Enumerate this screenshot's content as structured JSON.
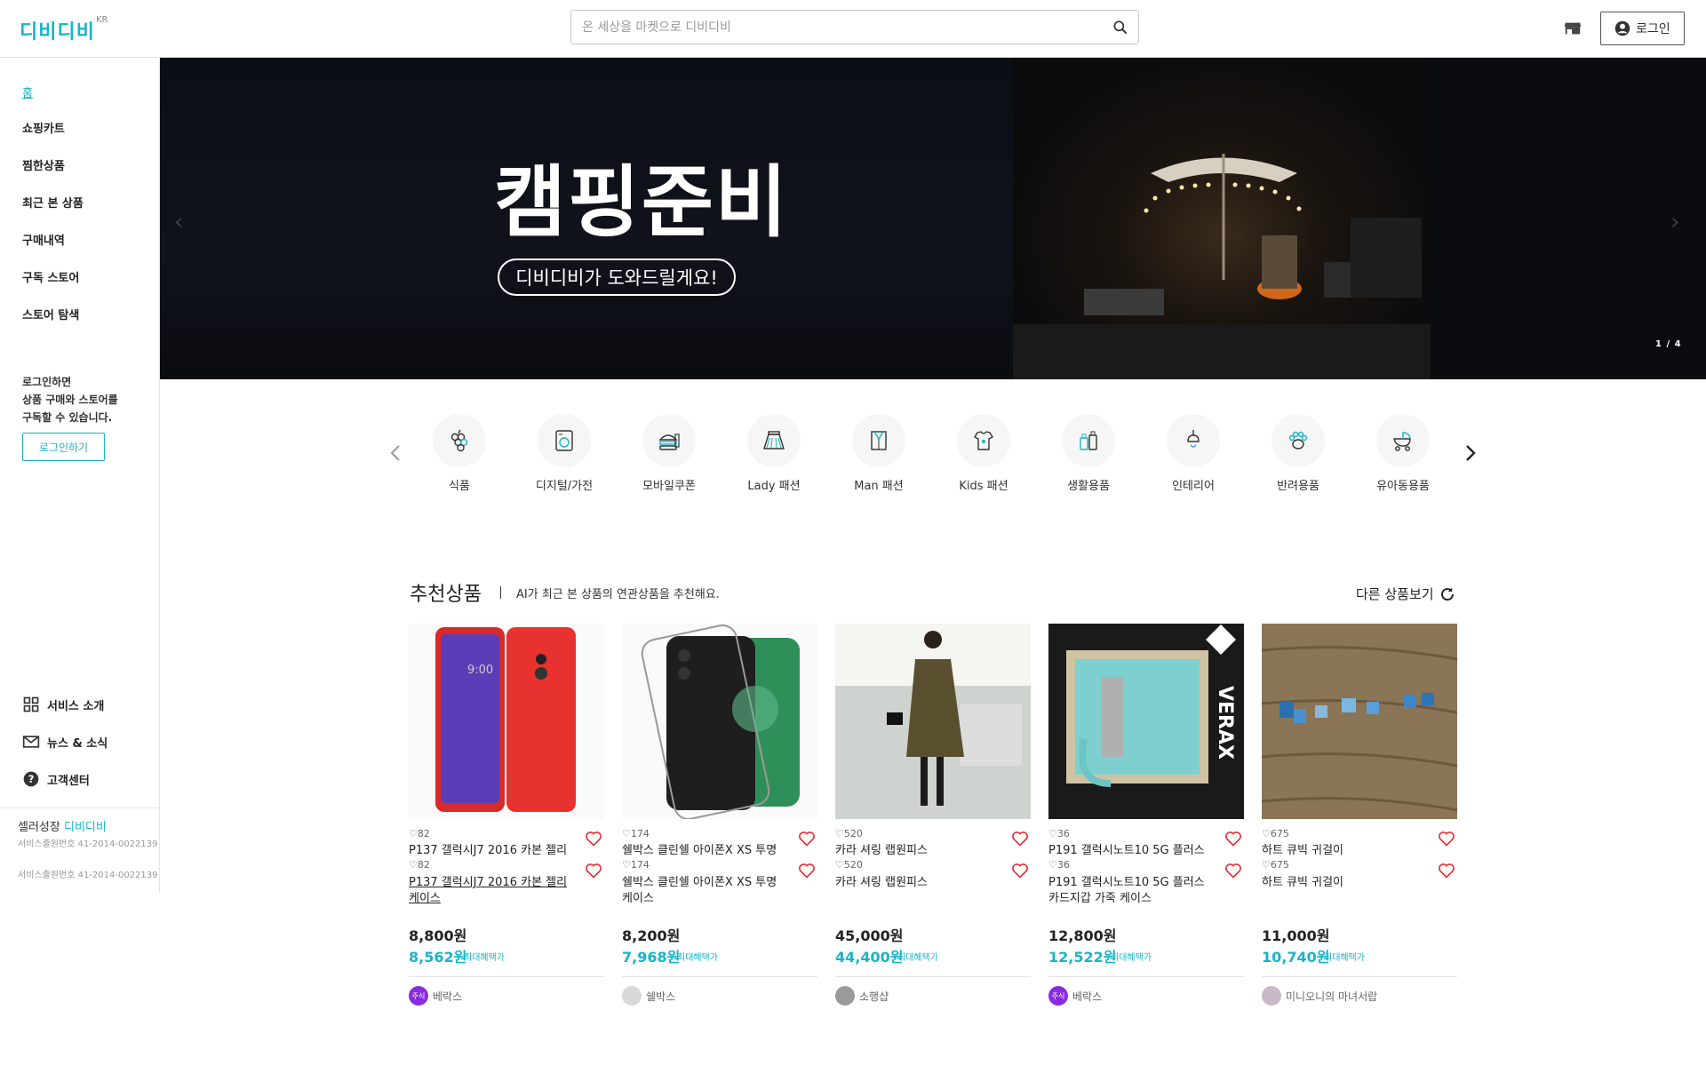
{
  "header": {
    "logo": "디비디비",
    "logo_sup": "KR",
    "search_placeholder": "온 세상을 마켓으로 디비디비",
    "login_label": "로그인"
  },
  "sidebar": {
    "nav": [
      {
        "label": "홈",
        "active": true
      },
      {
        "label": "쇼핑카트"
      },
      {
        "label": "찜한상품"
      },
      {
        "label": "최근 본 상품"
      },
      {
        "label": "구매내역"
      },
      {
        "label": "구독 스토어"
      },
      {
        "label": "스토어 탐색"
      }
    ],
    "login_note": [
      "로그인하면",
      "상품 구매와 스토어를",
      "구독할 수 있습니다."
    ],
    "login_button": "로그인하기",
    "links": [
      {
        "label": "서비스 소개",
        "icon": "grid-icon"
      },
      {
        "label": "뉴스 & 소식",
        "icon": "mail-icon"
      },
      {
        "label": "고객센터",
        "icon": "help-icon"
      }
    ],
    "seller_prefix": "셀러성장",
    "seller_brand": "디비디비",
    "biz_number": "서비스출원번호 41-2014-0022139"
  },
  "banner": {
    "title": "캠핑준비",
    "pill": "디비디비가 도와드릴게요!",
    "page": "1 / 4"
  },
  "categories": [
    {
      "label": "식품",
      "icon": "grapes-icon"
    },
    {
      "label": "디지털/가전",
      "icon": "washer-icon"
    },
    {
      "label": "모바일쿠폰",
      "icon": "burger-icon"
    },
    {
      "label": "Lady 패션",
      "icon": "skirt-icon"
    },
    {
      "label": "Man 패션",
      "icon": "shirt-icon"
    },
    {
      "label": "Kids 패션",
      "icon": "kids-shirt-icon"
    },
    {
      "label": "생활용품",
      "icon": "bottles-icon"
    },
    {
      "label": "인테리어",
      "icon": "lamp-icon"
    },
    {
      "label": "반려용품",
      "icon": "paw-icon"
    },
    {
      "label": "유아동용품",
      "icon": "stroller-icon"
    }
  ],
  "recommend": {
    "title": "추천상품",
    "subtitle": "AI가 최근 본 상품의 연관상품을 추천해요.",
    "more": "다른 상품보기",
    "products": [
      {
        "likes": "82",
        "name": "P137 갤럭시J7 2016 카본 젤리",
        "name_full": "P137 갤럭시J7 2016 카본 젤리 케이스",
        "price": "8,800원",
        "discount_price": "8,562원",
        "benefit": "최대혜택가",
        "store": "베락스",
        "store_avatar": "주식",
        "avatar_color": "#8a2be2"
      },
      {
        "likes": "174",
        "name": "쉘박스 클린쉘 아이폰X XS 투명",
        "name_full": "쉘박스 클린쉘 아이폰X XS 투명 케이스",
        "price": "8,200원",
        "discount_price": "7,968원",
        "benefit": "최대혜택가",
        "store": "쉘박스",
        "store_avatar": "",
        "avatar_color": "#d8d8d8"
      },
      {
        "likes": "520",
        "name": "카라 셔링 랩원피스",
        "name_full": "카라 셔링 랩원피스",
        "price": "45,000원",
        "discount_price": "44,400원",
        "benefit": "최대혜택가",
        "store": "소행샵",
        "store_avatar": "",
        "avatar_color": "#9a9a9a"
      },
      {
        "likes": "36",
        "name": "P191 갤럭시노트10 5G 플러스",
        "name_full": "P191 갤럭시노트10 5G 플러스 카드지갑 가죽 케이스",
        "price": "12,800원",
        "discount_price": "12,522원",
        "benefit": "최대혜택가",
        "store": "베락스",
        "store_avatar": "주식",
        "avatar_color": "#8a2be2"
      },
      {
        "likes": "675",
        "name": "하트 큐빅 귀걸이",
        "name_full": "하트 큐빅 귀걸이",
        "price": "11,000원",
        "discount_price": "10,740원",
        "benefit": "최대혜택가",
        "store": "미니오니의 마녀서랍",
        "store_avatar": "",
        "avatar_color": "#c9b8c8"
      }
    ]
  },
  "colors": {
    "accent": "#1ab3c8",
    "heart": "#e5323b"
  }
}
